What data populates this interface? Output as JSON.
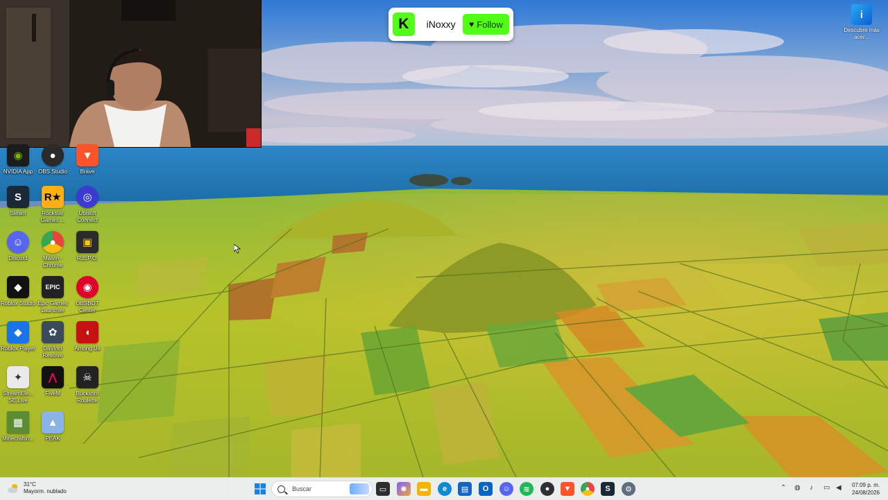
{
  "follow_widget": {
    "logo_letter": "K",
    "username": "iNoxxy",
    "button_label": "Follow"
  },
  "discover": {
    "label": "Descubre más acer..."
  },
  "desktop_icons": [
    {
      "label": "NVIDIA App",
      "icon": "nvidia-icon",
      "color": "#1b1b1b"
    },
    {
      "label": "OBS Studio",
      "icon": "obs-icon",
      "color": "#2a2a2a"
    },
    {
      "label": "Brave",
      "icon": "brave-icon",
      "color": "#fb542b"
    },
    {
      "label": "Steam",
      "icon": "steam-icon",
      "color": "#1b2838"
    },
    {
      "label": "Rockstar Games ...",
      "icon": "rockstar-icon",
      "color": "#fcaf17"
    },
    {
      "label": "Ubisoft Connect",
      "icon": "ubisoft-icon",
      "color": "#3b3bd1"
    },
    {
      "label": "Discord",
      "icon": "discord-icon",
      "color": "#5865f2"
    },
    {
      "label": "Malvin - Chrome",
      "icon": "chrome-icon",
      "color": "#e8453c"
    },
    {
      "label": "R.E.P.O.",
      "icon": "repo-icon",
      "color": "#2b2b2b"
    },
    {
      "label": "Roblox Studio",
      "icon": "roblox-studio-icon",
      "color": "#111111"
    },
    {
      "label": "Epic Games Launcher",
      "icon": "epic-games-icon",
      "color": "#222222"
    },
    {
      "label": "OBSBOT Center",
      "icon": "obsbot-icon",
      "color": "#e0002a"
    },
    {
      "label": "Roblox Player",
      "icon": "roblox-player-icon",
      "color": "#1a73e8"
    },
    {
      "label": "DaVinci Resolve",
      "icon": "davinci-icon",
      "color": "#3a4a5a"
    },
    {
      "label": "Among Us",
      "icon": "among-us-icon",
      "color": "#c51111"
    },
    {
      "label": "StreamEle... SE.Live",
      "icon": "streamelements-icon",
      "color": "#eaeaea"
    },
    {
      "label": "FiveM",
      "icon": "fivem-icon",
      "color": "#111111"
    },
    {
      "label": "Buckshot Roulette",
      "icon": "buckshot-icon",
      "color": "#222222"
    },
    {
      "label": "Minecraftin...",
      "icon": "minecraft-icon",
      "color": "#5b8c32"
    },
    {
      "label": "PEAK",
      "icon": "peak-icon",
      "color": "#8ab4e8"
    }
  ],
  "taskbar": {
    "weather_temp": "31°C",
    "weather_desc": "Mayorm. nublado",
    "search_placeholder": "Buscar",
    "clock_time": "07:09 p. m.",
    "clock_date": "24/08/2026",
    "apps": [
      {
        "name": "file-explorer-icon",
        "color": "#f2c14e"
      },
      {
        "name": "copilot-icon",
        "color": "#7b61ff"
      },
      {
        "name": "folder-icon",
        "color": "#f4b400"
      },
      {
        "name": "edge-icon",
        "color": "#0c8ad8"
      },
      {
        "name": "store-icon",
        "color": "#1565c0"
      },
      {
        "name": "outlook-icon",
        "color": "#0a64c2"
      },
      {
        "name": "discord-icon",
        "color": "#5865f2"
      },
      {
        "name": "spotify-icon",
        "color": "#1db954"
      },
      {
        "name": "obs-icon",
        "color": "#302e31"
      },
      {
        "name": "brave-icon",
        "color": "#fb542b"
      },
      {
        "name": "chrome-icon",
        "color": "#34a853"
      },
      {
        "name": "steam-icon",
        "color": "#1b2838"
      },
      {
        "name": "settings-icon",
        "color": "#5f6f80"
      }
    ]
  }
}
